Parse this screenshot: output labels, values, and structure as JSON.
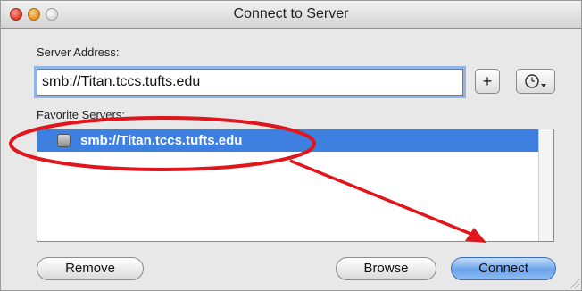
{
  "window": {
    "title": "Connect to Server"
  },
  "server_address": {
    "label": "Server Address:",
    "value": "smb://Titan.tccs.tufts.edu",
    "add_label": "+",
    "recent_icon": "clock-dropdown-icon"
  },
  "favorites": {
    "label": "Favorite Servers:",
    "items": [
      {
        "label": "smb://Titan.tccs.tufts.edu",
        "icon": "server-icon",
        "selected": true
      }
    ]
  },
  "buttons": {
    "remove": "Remove",
    "browse": "Browse",
    "connect": "Connect"
  },
  "annotation": {
    "color": "#e0161c"
  }
}
